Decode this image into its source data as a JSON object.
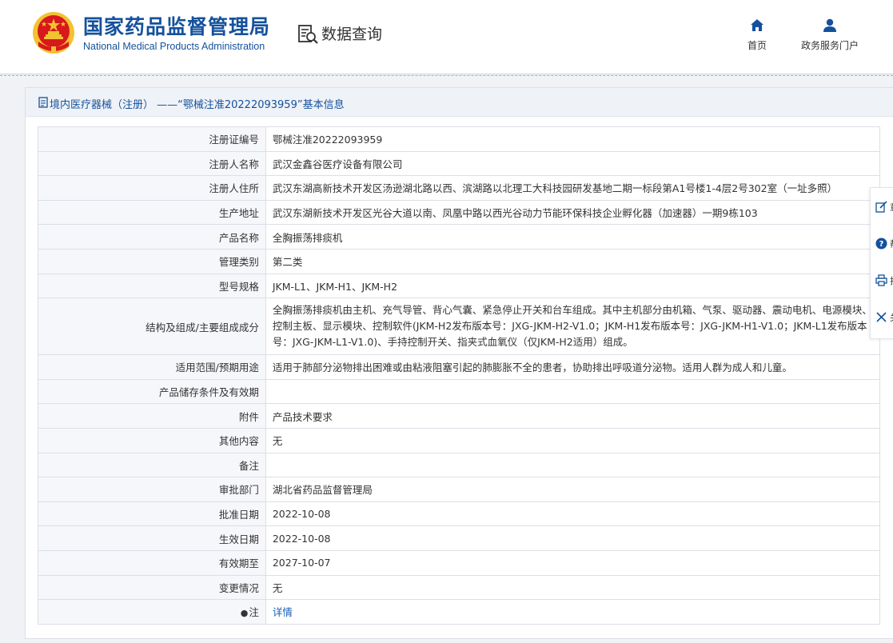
{
  "header": {
    "brand_cn": "国家药品监督管理局",
    "brand_en": "National Medical Products Administration",
    "section_title": "数据查询",
    "nav": [
      {
        "label": "首页",
        "icon": "home-icon"
      },
      {
        "label": "政务服务门户",
        "icon": "user-icon"
      }
    ]
  },
  "card": {
    "title": "境内医疗器械（注册） ——“鄂械注准20222093959”基本信息"
  },
  "rows": [
    {
      "key": "注册证编号",
      "value": "鄂械注准20222093959"
    },
    {
      "key": "注册人名称",
      "value": "武汉金鑫谷医疗设备有限公司"
    },
    {
      "key": "注册人住所",
      "value": "武汉东湖高新技术开发区汤逊湖北路以西、滨湖路以北理工大科技园研发基地二期一标段第A1号楼1-4层2号302室（一址多照）"
    },
    {
      "key": "生产地址",
      "value": "武汉东湖新技术开发区光谷大道以南、凤凰中路以西光谷动力节能环保科技企业孵化器（加速器）一期9栋103"
    },
    {
      "key": "产品名称",
      "value": "全胸振荡排痰机"
    },
    {
      "key": "管理类别",
      "value": "第二类"
    },
    {
      "key": "型号规格",
      "value": "JKM-L1、JKM-H1、JKM-H2"
    },
    {
      "key": "结构及组成/主要组成成分",
      "value": "全胸振荡排痰机由主机、充气导管、背心气囊、紧急停止开关和台车组成。其中主机部分由机箱、气泵、驱动器、震动电机、电源模块、控制主板、显示模块、控制软件(JKM-H2发布版本号：JXG-JKM-H2-V1.0；JKM-H1发布版本号：JXG-JKM-H1-V1.0；JKM-L1发布版本号：JXG-JKM-L1-V1.0)、手持控制开关、指夹式血氧仪（仅JKM-H2适用）组成。"
    },
    {
      "key": "适用范围/预期用途",
      "value": "适用于肺部分泌物排出困难或由粘液阻塞引起的肺膨胀不全的患者，协助排出呼吸道分泌物。适用人群为成人和儿童。"
    },
    {
      "key": "产品储存条件及有效期",
      "value": ""
    },
    {
      "key": "附件",
      "value": "产品技术要求"
    },
    {
      "key": "其他内容",
      "value": "无"
    },
    {
      "key": "备注",
      "value": ""
    },
    {
      "key": "审批部门",
      "value": "湖北省药品监督管理局"
    },
    {
      "key": "批准日期",
      "value": "2022-10-08"
    },
    {
      "key": "生效日期",
      "value": "2022-10-08"
    },
    {
      "key": "有效期至",
      "value": "2027-10-07"
    },
    {
      "key": "变更情况",
      "value": "无"
    }
  ],
  "note_row": {
    "icon": "lightbulb-icon",
    "key": "注",
    "link_text": "详情"
  },
  "float_tools": [
    {
      "icon": "edit-icon",
      "label": "意"
    },
    {
      "icon": "help-icon",
      "label": "帮"
    },
    {
      "icon": "print-icon",
      "label": "打"
    },
    {
      "icon": "close-icon",
      "label": "关"
    }
  ],
  "colors": {
    "brand": "#14519c",
    "link": "#1a5fb4",
    "emblem_red": "#d7191c",
    "emblem_gold": "#f2c230"
  }
}
